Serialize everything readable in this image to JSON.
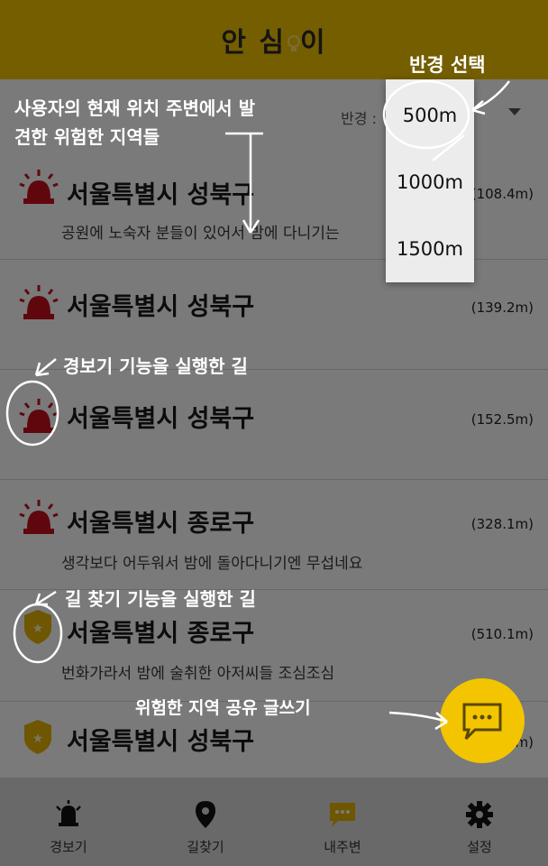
{
  "app": {
    "title": "안 심",
    "title_suffix": "이",
    "brand_color": "#f2c500"
  },
  "radius": {
    "label": "반경 :",
    "options": [
      "500m",
      "1000m",
      "1500m"
    ],
    "selected": "500m"
  },
  "items": [
    {
      "icon": "siren-icon",
      "place": "서울특별시 성북구",
      "distance": "(108.4m)",
      "message": "공원에 노숙자 분들이 있어서 밤에 다니기는"
    },
    {
      "icon": "siren-icon",
      "place": "서울특별시 성북구",
      "distance": "(139.2m)",
      "message": ""
    },
    {
      "icon": "siren-icon",
      "place": "서울특별시 성북구",
      "distance": "(152.5m)",
      "message": ""
    },
    {
      "icon": "siren-icon",
      "place": "서울특별시 종로구",
      "distance": "(328.1m)",
      "message": "생각보다 어두워서 밤에 돌아다니기엔 무섭네요"
    },
    {
      "icon": "shield-star-icon",
      "place": "서울특별시 종로구",
      "distance": "(510.1m)",
      "message": "번화가라서 밤에 술취한 아저씨들 조심조심"
    },
    {
      "icon": "shield-star-icon",
      "place": "서울특별시 성북구",
      "distance": "(520.3m)",
      "message": ""
    }
  ],
  "nav": [
    {
      "icon": "alarm-bell-icon",
      "label": "경보기"
    },
    {
      "icon": "map-pin-icon",
      "label": "길찾기"
    },
    {
      "icon": "chat-bubble-icon",
      "label": "내주변",
      "active": true
    },
    {
      "icon": "gear-icon",
      "label": "설정"
    }
  ],
  "fab": {
    "icon": "chat-bubble-icon"
  },
  "annotations": {
    "radius_select": "반경 선택",
    "nearby_line1": "사용자의 현재 위치 주변에서 발",
    "nearby_line2": "견한 위험한 지역들",
    "alarm_used": "경보기 기능을 실행한 길",
    "navigation_used": "길 찾기 기능을 실행한 길",
    "write_post": "위험한 지역 공유 글쓰기"
  },
  "colors": {
    "siren_red": "#c8101e",
    "shield_gold": "#e8b400",
    "overlay": "#000000"
  }
}
